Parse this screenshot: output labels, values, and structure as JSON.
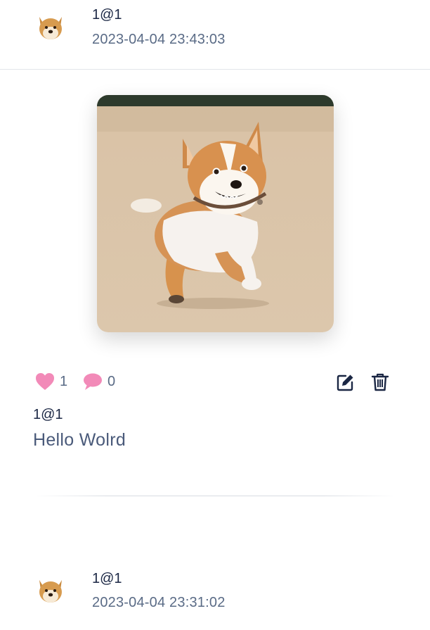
{
  "posts": [
    {
      "username": "1@1",
      "timestamp": "2023-04-04 23:43:03",
      "image_subject": "corgi running on sand",
      "likes": "1",
      "comments": "0",
      "author": "1@1",
      "content": "Hello Wolrd"
    },
    {
      "username": "1@1",
      "timestamp": "2023-04-04 23:31:02"
    }
  ],
  "colors": {
    "like": "#f28ab8",
    "comment": "#f28ab8",
    "icon_dark": "#1b2744",
    "text_muted": "#5a6b86"
  },
  "icons": {
    "like": "heart-icon",
    "comment": "speech-bubble-icon",
    "edit": "edit-icon",
    "delete": "trash-icon",
    "avatar": "doge-avatar"
  }
}
